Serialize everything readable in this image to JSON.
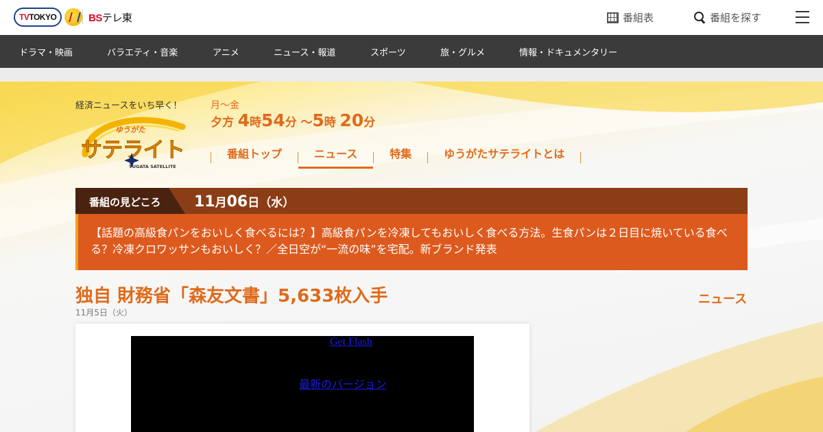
{
  "header": {
    "logo_tvtokyo_label": "TV TOKYO",
    "logo_bs_label": "BSテレ東",
    "schedule_label": "番組表",
    "search_label": "番組を探す",
    "icons": [
      "program-grid-icon",
      "search-icon",
      "hamburger-menu-icon"
    ]
  },
  "genre_nav": {
    "items": [
      {
        "label": "ドラマ・映画"
      },
      {
        "label": "バラエティ・音楽"
      },
      {
        "label": "アニメ"
      },
      {
        "label": "ニュース・報道"
      },
      {
        "label": "スポーツ"
      },
      {
        "label": "旅・グルメ"
      },
      {
        "label": "情報・ドキュメンタリー"
      }
    ]
  },
  "program": {
    "catchphrase": "経済ニュースをいち早く！",
    "logo_kana": "ゆうがた",
    "logo_main": "サテライト",
    "logo_en": "YUGATA SATELLITE",
    "days": "月～金",
    "time": {
      "prefix": "夕方",
      "start_hour": "4",
      "hour_unit": "時",
      "start_min": "54",
      "min_unit": "分",
      "tilde": "～",
      "end_hour": "5",
      "end_min": "20"
    },
    "subnav": [
      {
        "label": "番組トップ",
        "active": false
      },
      {
        "label": "ニュース",
        "active": true
      },
      {
        "label": "特集",
        "active": false
      },
      {
        "label": "ゆうがたサテライトとは",
        "active": false
      }
    ],
    "accent_color": "#e06a1a"
  },
  "highlight": {
    "tab_label": "番組の見どころ",
    "date": {
      "month": "11",
      "month_unit": "月",
      "day": "06",
      "day_unit": "日",
      "weekday": "（水）"
    },
    "text": "【話題の高級食パンをおいしく食べるには？】高級食パンを冷凍してもおいしく食べる方法。生食パンは２日目に焼いている食べる？冷凍クロワッサンもおいしく？／全日空が“一流の味”を宅配。新ブランド発表"
  },
  "article": {
    "title": "独自 財務省「森友文書」5,633枚入手",
    "date": "11月5日（火）",
    "category": "ニュース",
    "player": {
      "get_flash": "Get Flash",
      "latest_version": "最新のバージョン"
    }
  }
}
